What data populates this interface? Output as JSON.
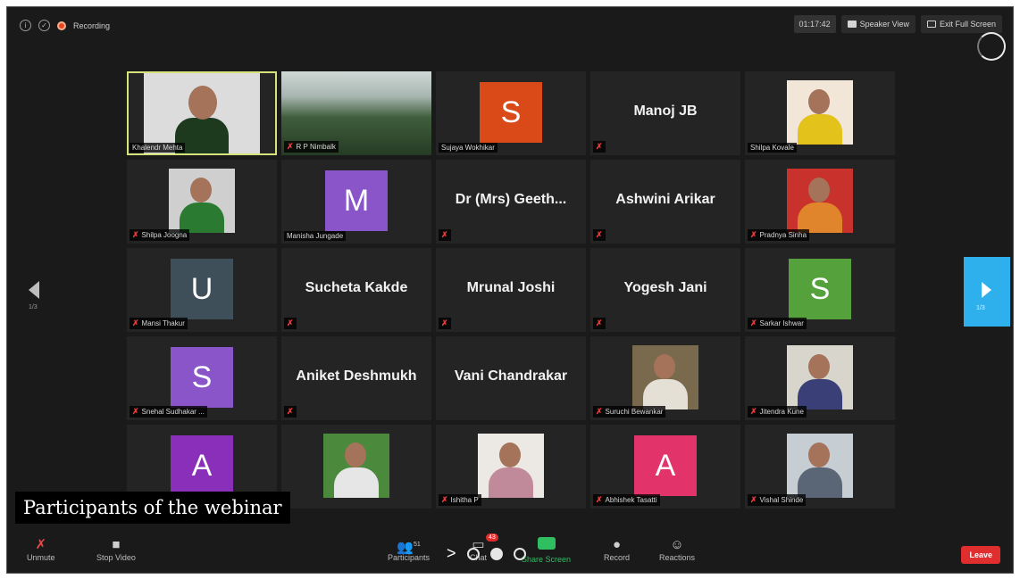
{
  "topbar": {
    "recording_label": "Recording",
    "timer": "01:17:42",
    "speaker_view": "Speaker View",
    "exit_full_screen": "Exit Full Screen"
  },
  "participants": [
    {
      "name": "Khalendr Mehta",
      "type": "photo",
      "active": true,
      "muted": false,
      "photo_bg": "#dcdcdc",
      "shirt": "#1d3a1f"
    },
    {
      "name": "R P Nimbalk",
      "type": "wide",
      "muted": true
    },
    {
      "name": "Sujaya Wokhikar",
      "type": "avatar",
      "letter": "S",
      "color": "#d94a18",
      "muted": false
    },
    {
      "name": "Manoj JB",
      "type": "name",
      "muted": true
    },
    {
      "name": "Shilpa Kovale",
      "type": "photo",
      "muted": false,
      "photo_bg": "#f1e6d8",
      "shirt": "#e3c21b"
    },
    {
      "name": "Shilpa Joogna",
      "type": "photo",
      "muted": true,
      "photo_bg": "#cfcfcf",
      "shirt": "#2b7a32"
    },
    {
      "name": "Manisha Jungade",
      "type": "avatar",
      "letter": "M",
      "color": "#8a55c9",
      "muted": false
    },
    {
      "name": "Dr (Mrs) Geeth...",
      "type": "name",
      "muted": true
    },
    {
      "name": "Ashwini Arikar",
      "type": "name",
      "muted": true
    },
    {
      "name": "Pradnya Sinha",
      "type": "photo",
      "muted": true,
      "photo_bg": "#c9312c",
      "shirt": "#e0852c"
    },
    {
      "name": "Mansi Thakur",
      "type": "avatar",
      "letter": "U",
      "color": "#3e4f5a",
      "muted": true
    },
    {
      "name": "Sucheta Kakde",
      "type": "name",
      "muted": true
    },
    {
      "name": "Mrunal Joshi",
      "type": "name",
      "muted": true
    },
    {
      "name": "Yogesh Jani",
      "type": "name",
      "muted": true
    },
    {
      "name": "Sarkar Ishwar",
      "type": "avatar",
      "letter": "S",
      "color": "#55a23c",
      "muted": true
    },
    {
      "name": "Snehal Sudhakar ...",
      "type": "avatar",
      "letter": "S",
      "color": "#8a55c9",
      "muted": true
    },
    {
      "name": "Aniket Deshmukh",
      "type": "name",
      "muted": true
    },
    {
      "name": "Vani Chandrakar",
      "type": "name",
      "muted": false
    },
    {
      "name": "Suruchi Bewankar",
      "type": "photo",
      "muted": true,
      "photo_bg": "#7a6a4d",
      "shirt": "#e5e0d6"
    },
    {
      "name": "Jitendra Kune",
      "type": "photo",
      "muted": true,
      "photo_bg": "#d8d5cd",
      "shirt": "#3a3f77"
    },
    {
      "name": "",
      "type": "avatar",
      "letter": "A",
      "color": "#8a2fb9",
      "muted": false
    },
    {
      "name": "",
      "type": "photo",
      "muted": false,
      "photo_bg": "#4b8a3c",
      "shirt": "#e6e6e6"
    },
    {
      "name": "Ishitha P",
      "type": "photo",
      "muted": true,
      "photo_bg": "#ece8e4",
      "shirt": "#c18a9a"
    },
    {
      "name": "Abhishek Tasatti",
      "type": "avatar",
      "letter": "A",
      "color": "#e2346b",
      "muted": true
    },
    {
      "name": "Vishal Shinde",
      "type": "photo",
      "muted": true,
      "photo_bg": "#c6cdd3",
      "shirt": "#5a6675"
    }
  ],
  "nav": {
    "left_page": "1/3",
    "right_page": "1/3"
  },
  "toolbar": {
    "unmute": "Unmute",
    "stop_video": "Stop Video",
    "participants": "Participants",
    "participants_count": "51",
    "chat": "Chat",
    "chat_badge": "43",
    "share_screen": "Share Screen",
    "record": "Record",
    "reactions": "Reactions",
    "leave": "Leave"
  },
  "caption": "Participants of the webinar"
}
